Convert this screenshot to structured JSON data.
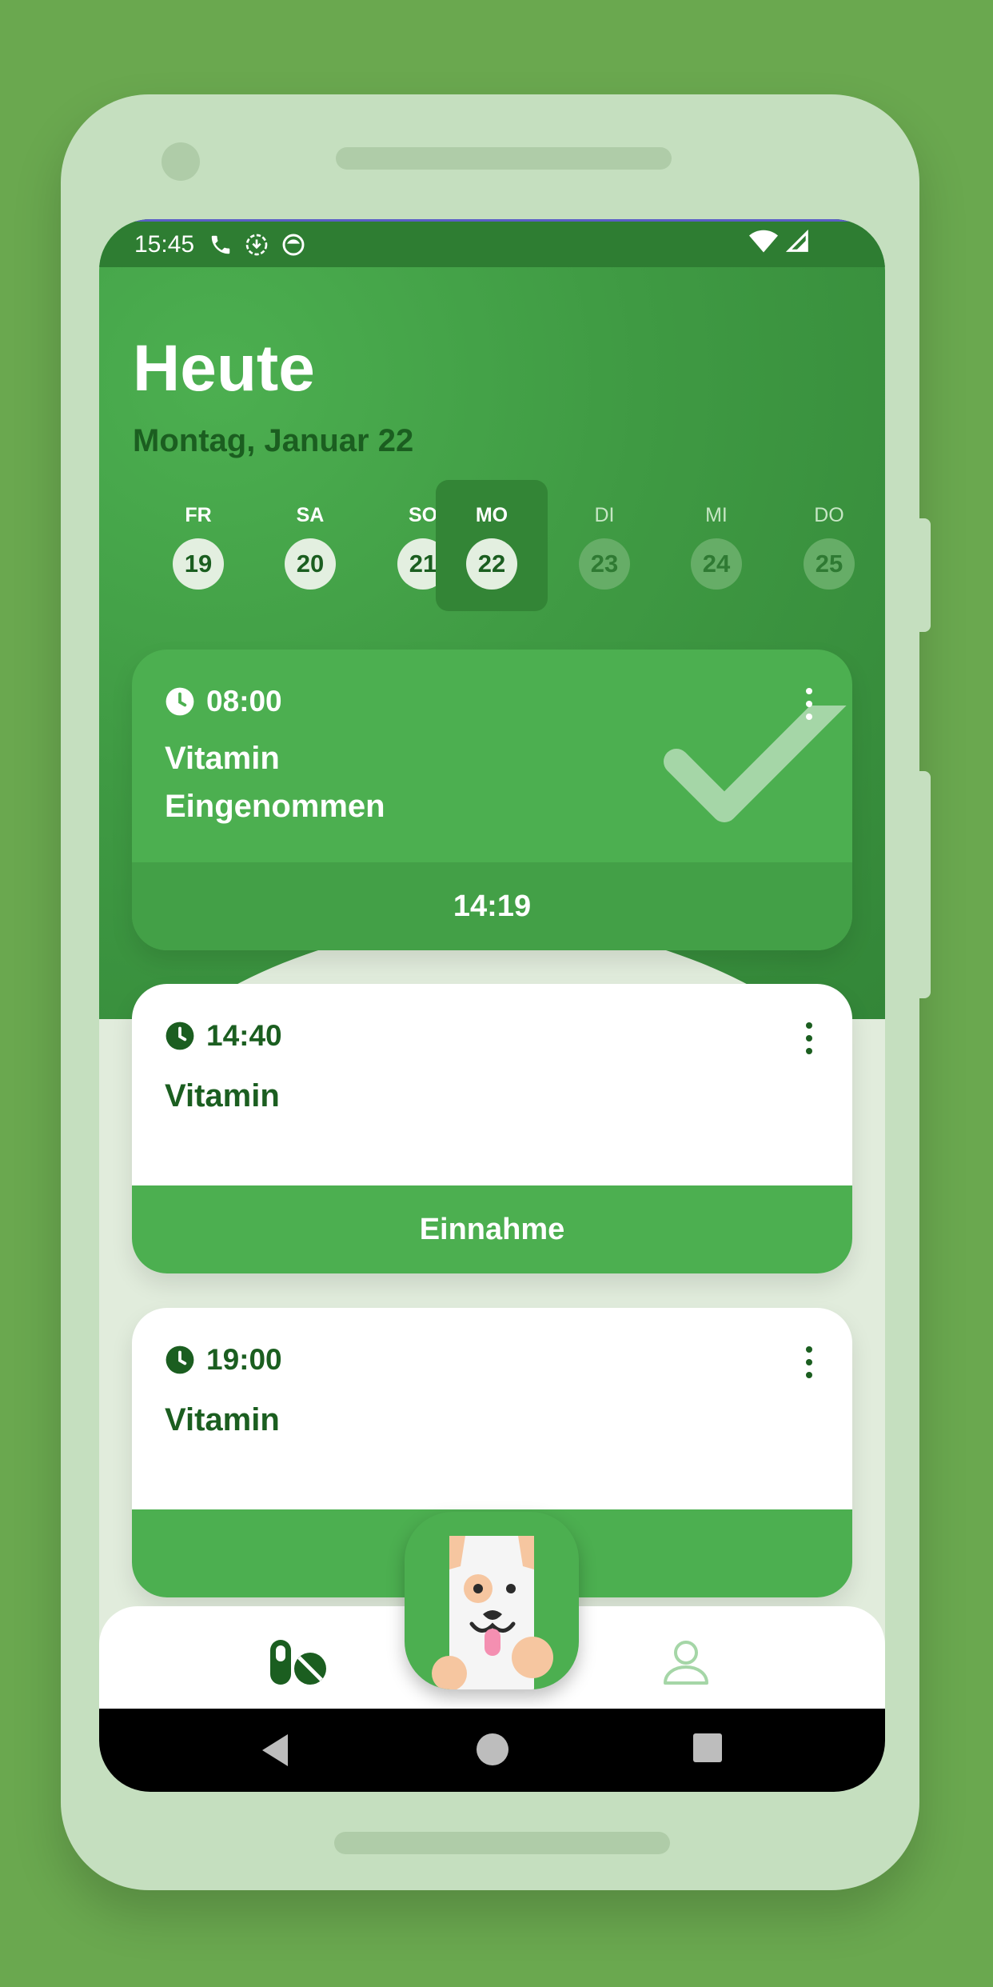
{
  "status_bar": {
    "time": "15:45"
  },
  "header": {
    "title": "Heute",
    "date": "Montag, Januar 22"
  },
  "days": [
    {
      "name": "FR",
      "num": "19",
      "state": "past"
    },
    {
      "name": "SA",
      "num": "20",
      "state": "past"
    },
    {
      "name": "SO",
      "num": "21",
      "state": "past"
    },
    {
      "name": "MO",
      "num": "22",
      "state": "active"
    },
    {
      "name": "DI",
      "num": "23",
      "state": "future"
    },
    {
      "name": "MI",
      "num": "24",
      "state": "future"
    },
    {
      "name": "DO",
      "num": "25",
      "state": "future"
    }
  ],
  "cards": [
    {
      "time": "08:00",
      "title_line1": "Vitamin",
      "title_line2": "Eingenommen",
      "footer": "14:19",
      "status": "done"
    },
    {
      "time": "14:40",
      "title_line1": "Vitamin",
      "footer": "Einnahme",
      "status": "pending"
    },
    {
      "time": "19:00",
      "title_line1": "Vitamin",
      "footer": "",
      "status": "pending"
    }
  ],
  "bottom_nav": {
    "left_icon": "pill-icon",
    "center_icon": "dog-mascot-icon",
    "right_icon": "user-icon"
  },
  "system_nav": {
    "back_icon": "back-triangle-icon",
    "home_icon": "home-circle-icon",
    "recents_icon": "recents-square-icon"
  },
  "colors": {
    "primary": "#4caf50",
    "dark_green": "#1b5e20",
    "status_bar": "#2e7d32",
    "background": "#6aa84f"
  }
}
